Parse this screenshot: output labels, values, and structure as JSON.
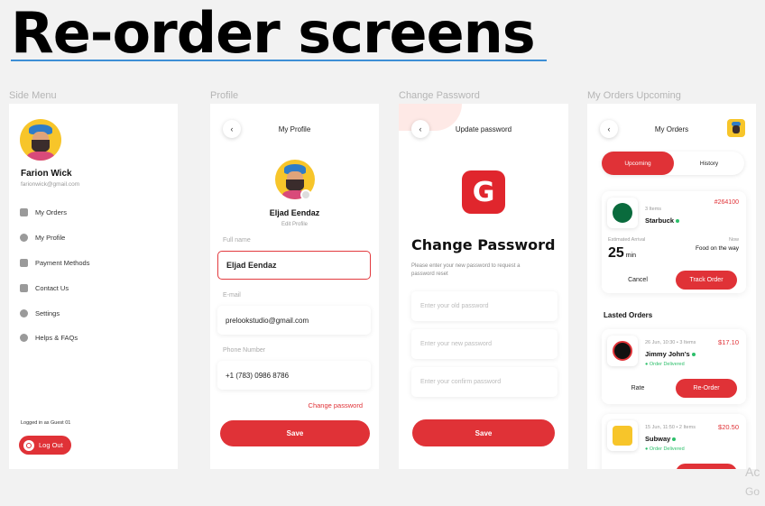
{
  "page_title": "Re-order screens",
  "sections": {
    "side_menu": "Side Menu",
    "profile": "Profile",
    "change_password": "Change Password",
    "my_orders": "My Orders Upcoming"
  },
  "side_menu": {
    "user_name": "Farion Wick",
    "user_email": "farionwick@gmail.com",
    "items": [
      {
        "label": "My Orders",
        "icon": "orders-icon"
      },
      {
        "label": "My Profile",
        "icon": "profile-icon"
      },
      {
        "label": "Payment Methods",
        "icon": "wallet-icon"
      },
      {
        "label": "Contact Us",
        "icon": "mail-icon"
      },
      {
        "label": "Settings",
        "icon": "gear-icon"
      },
      {
        "label": "Helps & FAQs",
        "icon": "help-icon"
      }
    ],
    "logged_in_text": "Logged in as Guest 01",
    "logout_label": "Log Out"
  },
  "profile": {
    "header_title": "My Profile",
    "name": "Eljad Eendaz",
    "edit_label": "Edit Profile",
    "full_name_label": "Full name",
    "full_name_value": "Eljad Eendaz",
    "email_label": "E-mail",
    "email_value": "prelookstudio@gmail.com",
    "phone_label": "Phone Number",
    "phone_value": "+1 (783) 0986 8786",
    "change_password_link": "Change password",
    "save_label": "Save"
  },
  "change_password": {
    "header_title": "Update password",
    "logo_letter": "G",
    "title": "Change Password",
    "description": "Please enter your new password to request a password reset",
    "old_placeholder": "Enter your old password",
    "new_placeholder": "Enter your new password",
    "confirm_placeholder": "Enter your confirm password",
    "save_label": "Save"
  },
  "my_orders": {
    "header_title": "My Orders",
    "tab_upcoming": "Upcoming",
    "tab_history": "History",
    "current": {
      "items": "3 Items",
      "store": "Starbuck",
      "order_id": "#264100",
      "arrival_label": "Estimated Arrival",
      "arrival_value": "25",
      "arrival_unit": "min",
      "now_label": "Now",
      "now_status": "Food on the way",
      "cancel_label": "Cancel",
      "track_label": "Track Order"
    },
    "lasted_label": "Lasted Orders",
    "history": [
      {
        "meta": "26 Jun, 10:30  •  3 Items",
        "store": "Jimmy John's",
        "price": "$17.10",
        "status": "Order Delivered",
        "rate_label": "Rate",
        "reorder_label": "Re-Order"
      },
      {
        "meta": "15 Jun, 11:50  •  2 Items",
        "store": "Subway",
        "price": "$20.50",
        "status": "Order Delivered"
      }
    ]
  },
  "watermark": {
    "line1": "Ac",
    "line2": "Go"
  },
  "colors": {
    "accent": "#e03237",
    "success": "#2cbf6a",
    "underline": "#3d8fd6"
  }
}
